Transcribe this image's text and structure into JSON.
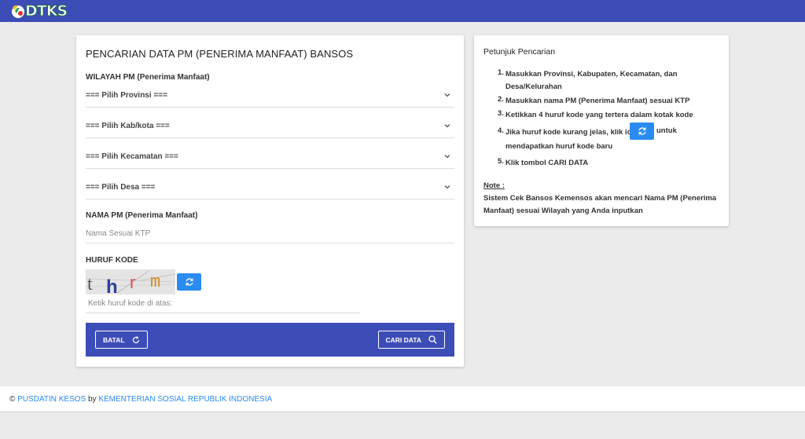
{
  "header": {
    "logo_text": "DTKS"
  },
  "form": {
    "title": "PENCARIAN DATA PM (PENERIMA MANFAAT) BANSOS",
    "wilayah_label": "WILAYAH PM (Penerima Manfaat)",
    "selects": {
      "provinsi": "=== Pilih Provinsi ===",
      "kabkota": "=== Pilih Kab/kota ===",
      "kecamatan": "=== Pilih Kecamatan ===",
      "desa": "=== Pilih Desa ==="
    },
    "nama_label": "NAMA PM (Penerima Manfaat)",
    "nama_placeholder": "Nama Sesuai KTP",
    "kode_label": "HURUF KODE",
    "captcha_text": "thrm",
    "kode_placeholder": "Ketik huruf kode di atas:",
    "batal_label": "BATAL",
    "cari_label": "CARI DATA"
  },
  "instructions": {
    "title": "Petunjuk Pencarian",
    "steps": [
      {
        "num": "1.",
        "text": "Masukkan Provinsi, Kabupaten, Kecamatan, dan Desa/Kelurahan"
      },
      {
        "num": "2.",
        "text": "Masukkan nama PM (Penerima Manfaat) sesuai KTP"
      },
      {
        "num": "3.",
        "text": "Ketikkan 4 huruf kode yang tertera dalam kotak kode"
      },
      {
        "num": "4.",
        "text_before": "Jika huruf kode kurang jelas, klik icon",
        "text_after": "untuk",
        "text_cont": "mendapatkan huruf kode baru"
      },
      {
        "num": "5.",
        "text": "Klik tombol CARI DATA"
      }
    ],
    "note_label": "Note :",
    "note_text": "Sistem Cek Bansos Kemensos akan mencari Nama PM (Penerima Manfaat) sesuai Wilayah yang Anda inputkan"
  },
  "footer": {
    "copyright": "©",
    "org1": "PUSDATIN KESOS",
    "by": "by",
    "org2": "KEMENTERIAN SOSIAL REPUBLIK INDONESIA"
  },
  "colors": {
    "primary": "#3d4db7",
    "accent": "#2a8cf0",
    "background": "#ebebeb"
  },
  "icons": [
    "dtks-logo-icon",
    "chevron-down-icon",
    "refresh-icon",
    "search-icon"
  ]
}
